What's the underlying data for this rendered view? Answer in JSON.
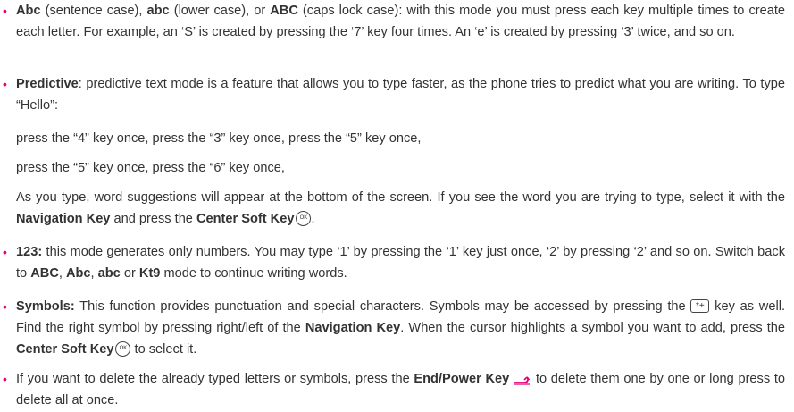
{
  "bullets": {
    "abc": {
      "bold1": "Abc",
      "t1": " (sentence case), ",
      "bold2": "abc",
      "t2": " (lower case), or ",
      "bold3": "ABC",
      "t3": " (caps lock case): with this mode you must press each key multiple times to create each letter. For example, an ‘S’ is created by pressing the ‘7’ key four times. An ‘e’ is created by pressing ‘3’ twice, and so on."
    },
    "predictive": {
      "bold1": "Predictive",
      "t1": ": predictive text mode is a feature that allows you to type faster, as the phone tries to predict what you are writing. To type “Hello”:",
      "line2": "press the “4” key once, press the “3” key once, press the “5” key once,",
      "line3": "press the “5” key once, press the “6” key once,",
      "line4_t1": "As you type, word suggestions will appear at the bottom of the screen. If you see the word you are trying to type, select it with the ",
      "line4_bold1": "Navigation Key",
      "line4_t2": " and press the ",
      "line4_bold2": "Center Soft Key",
      "line4_t3": "."
    },
    "numbers": {
      "bold1": "123:",
      "t1": " this mode generates only numbers. You may type ‘1’ by pressing the ‘1’ key just once, ‘2’ by pressing ‘2’ and so on. Switch back to ",
      "bold2": "ABC",
      "t2": ", ",
      "bold3": "Abc",
      "t3": ", ",
      "bold4": "abc",
      "t4": " or ",
      "bold5": "Kt9",
      "t5": " mode to continue writing words."
    },
    "symbols": {
      "bold1": "Symbols:",
      "t1": " This function provides punctuation and special characters. Symbols may be accessed by pressing the ",
      "t2": " key as well. Find the right symbol by pressing right/left of the ",
      "bold2": "Navigation Key",
      "t3": ". When the cursor highlights a symbol you want to add, press the ",
      "bold3": "Center Soft Key",
      "t4": " to select it."
    },
    "delete": {
      "t1": "If you want to delete the already typed letters or symbols, press the ",
      "bold1": "End/Power Key",
      "t2": " to delete them one by one or long press to delete all at once."
    }
  },
  "icons": {
    "ok_key": "OK",
    "star_key": "*+"
  },
  "colors": {
    "bullet": "#e20074",
    "text": "#333333",
    "end_key": "#e20074"
  }
}
